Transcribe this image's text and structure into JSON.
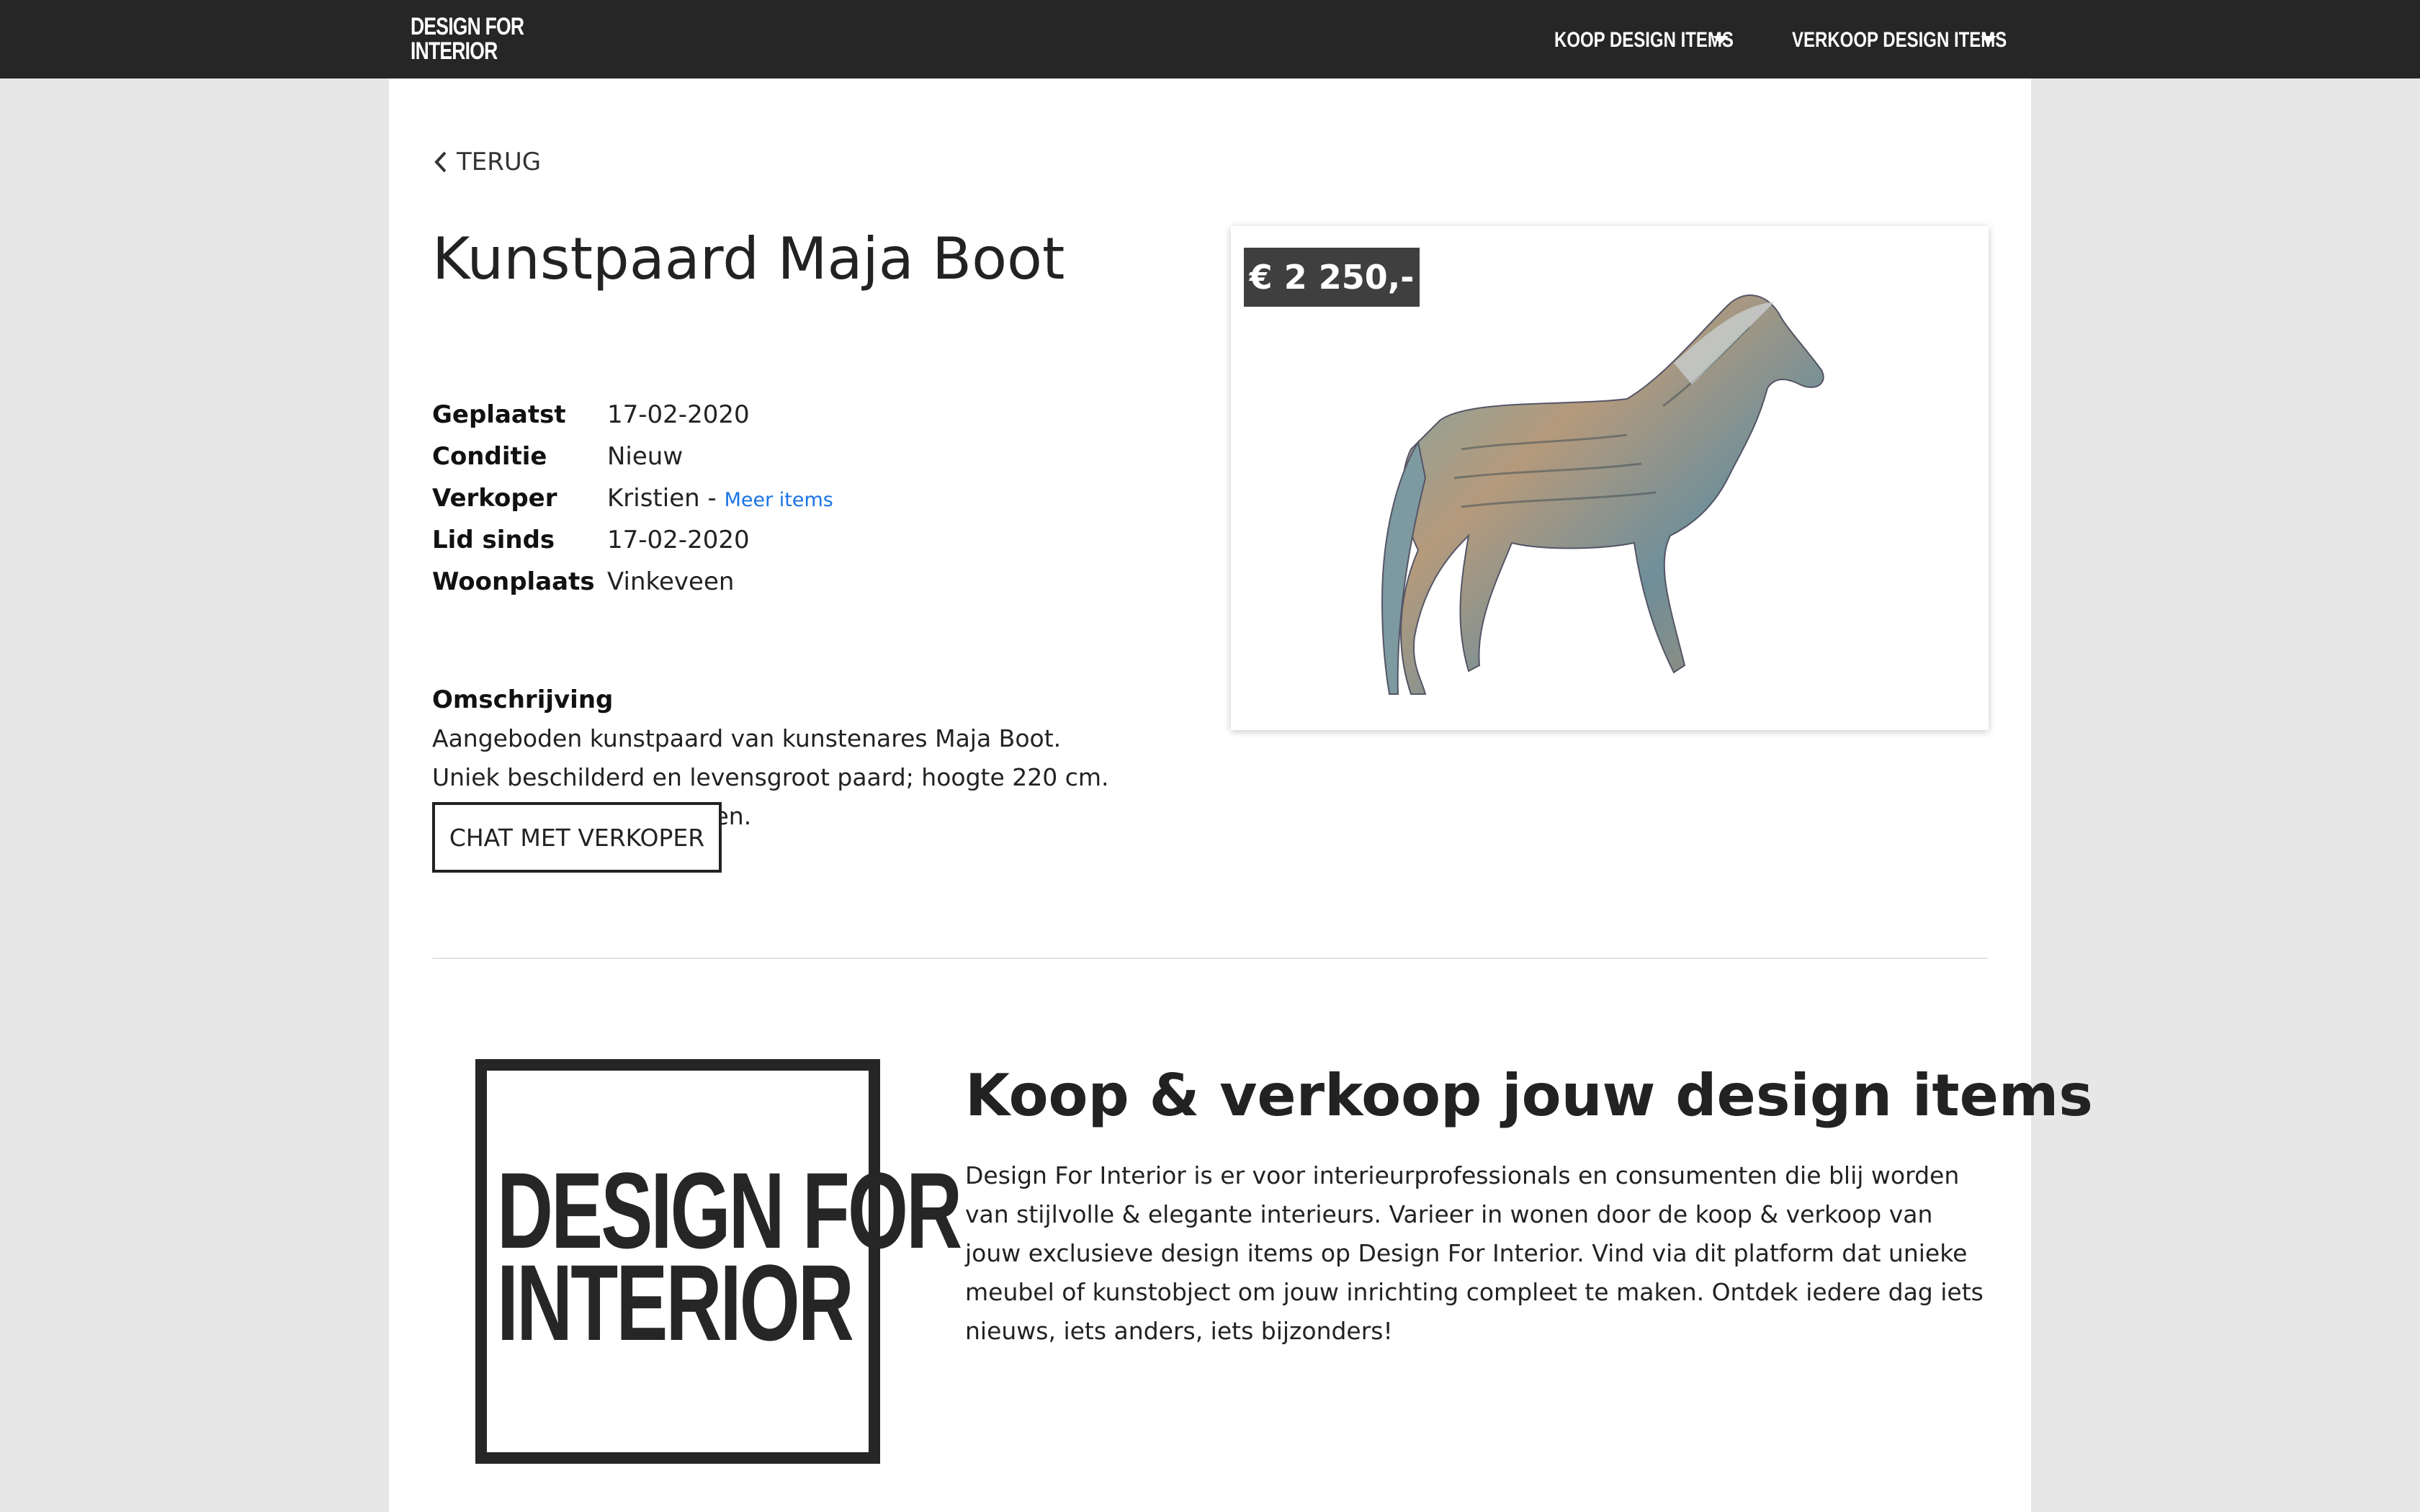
{
  "navbar": {
    "brand_line1": "DESIGN FOR",
    "brand_line2": "INTERIOR",
    "items": [
      {
        "label": "KOOP DESIGN ITEMS"
      },
      {
        "label": "VERKOOP DESIGN ITEMS"
      }
    ]
  },
  "product": {
    "back_label": "TERUG",
    "title": "Kunstpaard Maja Boot",
    "details": [
      {
        "key": "Geplaatst",
        "value": "17-02-2020"
      },
      {
        "key": "Conditie",
        "value": "Nieuw"
      },
      {
        "key": "Verkoper",
        "value": "Kristien -",
        "link": "Meer items"
      },
      {
        "key": "Lid sinds",
        "value": "17-02-2020"
      },
      {
        "key": "Woonplaats",
        "value": "Vinkeveen"
      }
    ],
    "description_title": "Omschrijving",
    "description_lines": [
      "Aangeboden kunstpaard van kunstenares Maja Boot.",
      "Uniek beschilderd en levensgroot paard; hoogte 220 cm.",
      "Voor vragen kun je mailen."
    ],
    "chat_button": "CHAT MET VERKOPER",
    "price": "€ 2 250,-"
  },
  "about": {
    "logo_line1": "DESIGN FOR",
    "logo_line2": "INTERIOR",
    "title": "Koop & verkoop jouw design items",
    "text": "Design For Interior is er voor interieurprofessionals en consumenten die blij worden van stijlvolle & elegante interieurs. Varieer in wonen door de koop & verkoop van jouw exclusieve design items op Design For Interior. Vind via dit platform dat unieke meubel of kunstobject om jouw inrichting compleet te maken. Ontdek iedere dag iets nieuws, iets anders, iets bijzonders!"
  },
  "colors": {
    "navbar_bg": "#262626",
    "page_bg": "#e7e7e7",
    "link": "#1a73e8",
    "price_badge": "#3f3f3f"
  },
  "icons": [
    "chevron-left-icon",
    "heart-icon",
    "caret-down-icon"
  ]
}
